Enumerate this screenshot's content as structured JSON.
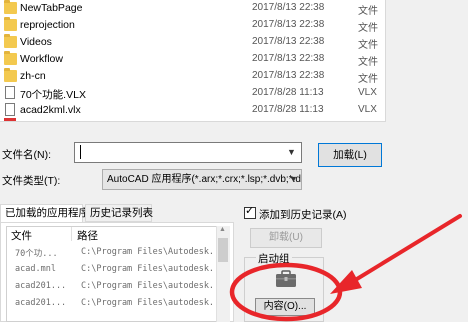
{
  "file_list": {
    "rows": [
      {
        "name": "NewTabPage",
        "date": "2017/8/13 22:38",
        "type": "文件",
        "icon": "folder-icon"
      },
      {
        "name": "reprojection",
        "date": "2017/8/13 22:38",
        "type": "文件",
        "icon": "folder-icon"
      },
      {
        "name": "Videos",
        "date": "2017/8/13 22:38",
        "type": "文件",
        "icon": "folder-icon"
      },
      {
        "name": "Workflow",
        "date": "2017/8/13 22:38",
        "type": "文件",
        "icon": "folder-icon"
      },
      {
        "name": "zh-cn",
        "date": "2017/8/13 22:38",
        "type": "文件",
        "icon": "folder-icon"
      },
      {
        "name": "70个功能.VLX",
        "date": "2017/8/28 11:13",
        "type": "VLX",
        "icon": "document-icon"
      },
      {
        "name": "acad2kml.vlx",
        "date": "2017/8/28 11:13",
        "type": "VLX",
        "icon": "document-icon"
      }
    ]
  },
  "form": {
    "filename_label": "文件名(N):",
    "filename_value": "",
    "load_button": "加载(L)",
    "filetype_label": "文件类型(T):",
    "filetype_value": "AutoCAD 应用程序(*.arx;*.crx;*.lsp;*.dvb;*.dbx"
  },
  "tabs": {
    "loaded": "已加载的应用程序",
    "history": "历史记录列表"
  },
  "apps_table": {
    "headers": {
      "file": "文件",
      "path": "路径"
    },
    "rows": [
      {
        "file": "70个功...",
        "path": "C:\\Program Files\\Autodesk..."
      },
      {
        "file": "acad.mnl",
        "path": "C:\\Program Files\\autodesk..."
      },
      {
        "file": "acad201...",
        "path": "C:\\Program Files\\autodesk..."
      },
      {
        "file": "acad201...",
        "path": "C:\\Program Files\\autodesk..."
      }
    ]
  },
  "options": {
    "add_to_history_label": "添加到历史记录(A)",
    "add_to_history_checked": true,
    "unload_button": "卸载(U)",
    "startup_group_label": "启动组",
    "startup_icon": "briefcase-icon",
    "contents_button": "内容(O)..."
  },
  "colors": {
    "annotation_red": "#e8262a",
    "focus_blue": "#0078d7"
  }
}
